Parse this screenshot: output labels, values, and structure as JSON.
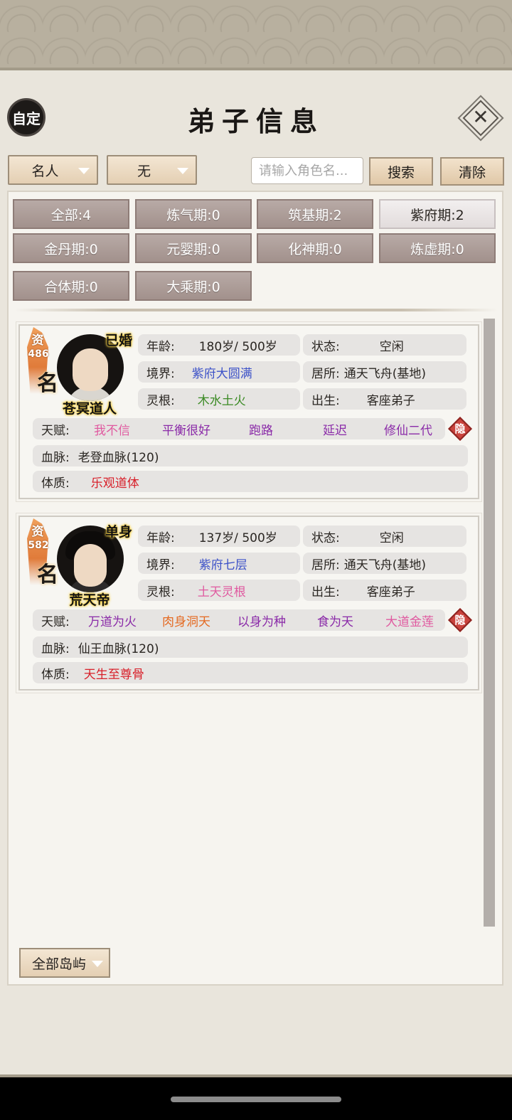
{
  "header": {
    "auto_label": "自定",
    "title": "弟子信息",
    "close_symbol": "✕"
  },
  "filters": {
    "category_dropdown": "名人",
    "secondary_dropdown": "无",
    "search_placeholder": "请输入角色名...",
    "search_value": "",
    "search_button": "搜索",
    "clear_button": "清除"
  },
  "realm_filters": [
    {
      "label": "全部:4",
      "active": false
    },
    {
      "label": "炼气期:0",
      "active": false
    },
    {
      "label": "筑基期:2",
      "active": false
    },
    {
      "label": "紫府期:2",
      "active": true
    },
    {
      "label": "金丹期:0",
      "active": false
    },
    {
      "label": "元婴期:0",
      "active": false
    },
    {
      "label": "化神期:0",
      "active": false
    },
    {
      "label": "炼虚期:0",
      "active": false
    },
    {
      "label": "合体期:0",
      "active": false
    },
    {
      "label": "大乘期:0",
      "active": false
    }
  ],
  "labels": {
    "age": "年龄:",
    "status": "状态:",
    "realm": "境界:",
    "residence": "居所:",
    "root": "灵根:",
    "origin": "出生:",
    "talent": "天赋:",
    "bloodline": "血脉:",
    "physique": "体质:",
    "aptitude": "资",
    "fame": "名",
    "hide": "隐"
  },
  "disciples": [
    {
      "name": "苍冥道人",
      "marital": "已婚",
      "aptitude": "486",
      "age": "180岁/ 500岁",
      "status": "空闲",
      "realm": "紫府大圆满",
      "residence": "通天飞舟(基地)",
      "root": "木水土火",
      "origin": "客座弟子",
      "talents": [
        "我不信",
        "平衡很好",
        "跑路",
        "延迟",
        "修仙二代"
      ],
      "bloodline": "老登血脉(120)",
      "physique": "乐观道体"
    },
    {
      "name": "荒天帝",
      "marital": "单身",
      "aptitude": "582",
      "age": "137岁/ 500岁",
      "status": "空闲",
      "realm": "紫府七层",
      "residence": "通天飞舟(基地)",
      "root": "土天灵根",
      "origin": "客座弟子",
      "talents": [
        "万道为火",
        "肉身洞天",
        "以身为种",
        "食为天",
        "大道金莲"
      ],
      "bloodline": "仙王血脉(120)",
      "physique": "天生至尊骨"
    }
  ],
  "footer": {
    "island_dropdown": "全部岛屿"
  },
  "colors": {
    "panel_bg": "#e9e5dc",
    "realm_blue": "#3d52c8",
    "talent_pink": "#e05aa0",
    "talent_purple": "#8a2aa8",
    "talent_orange": "#e46a22",
    "physique_red": "#d8202a",
    "root_green": "#3b8a24",
    "hide_red": "#c9433d"
  }
}
